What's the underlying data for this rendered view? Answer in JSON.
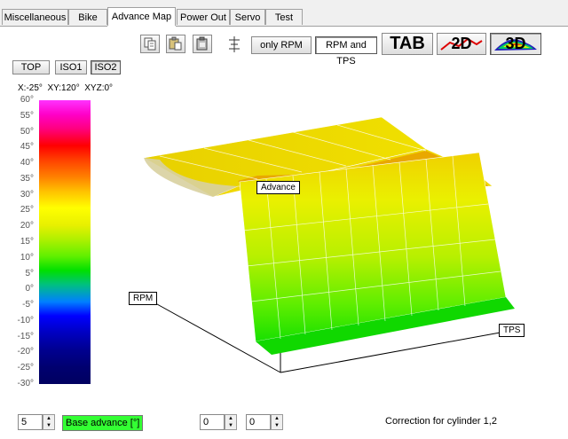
{
  "tabs": [
    {
      "label": "Miscellaneous"
    },
    {
      "label": "Bike"
    },
    {
      "label": "Advance Map"
    },
    {
      "label": "Power Out"
    },
    {
      "label": "Servo"
    },
    {
      "label": "Test"
    }
  ],
  "active_tab": "Advance Map",
  "toolbar": {
    "only_rpm": "only RPM",
    "rpm_and_tps": "RPM and TPS",
    "tab": "TAB",
    "two_d": "2D",
    "three_d": "3D",
    "icons": [
      "copy-icon",
      "paste-icon",
      "clipboard-icon",
      "align-icon"
    ]
  },
  "view_buttons": {
    "top": "TOP",
    "iso1": "ISO1",
    "iso2": "ISO2"
  },
  "rotation": "X:-25°  XY:120°  XYZ:0°",
  "legend": {
    "ticks": [
      "60°",
      "55°",
      "50°",
      "45°",
      "40°",
      "35°",
      "30°",
      "25°",
      "20°",
      "15°",
      "10°",
      "5°",
      "0°",
      "-5°",
      "-10°",
      "-15°",
      "-20°",
      "-25°",
      "-30°"
    ]
  },
  "plot_labels": {
    "advance": "Advance",
    "rpm": "RPM",
    "tps": "TPS"
  },
  "bottom": {
    "step_value": "5",
    "base_advance": "Base advance [°]",
    "spin1": "0",
    "spin2": "0",
    "correction": "Correction for cylinder 1,2"
  },
  "colors": {
    "accent_green": "#33ff33",
    "active_tab_bg": "#ffffff"
  }
}
